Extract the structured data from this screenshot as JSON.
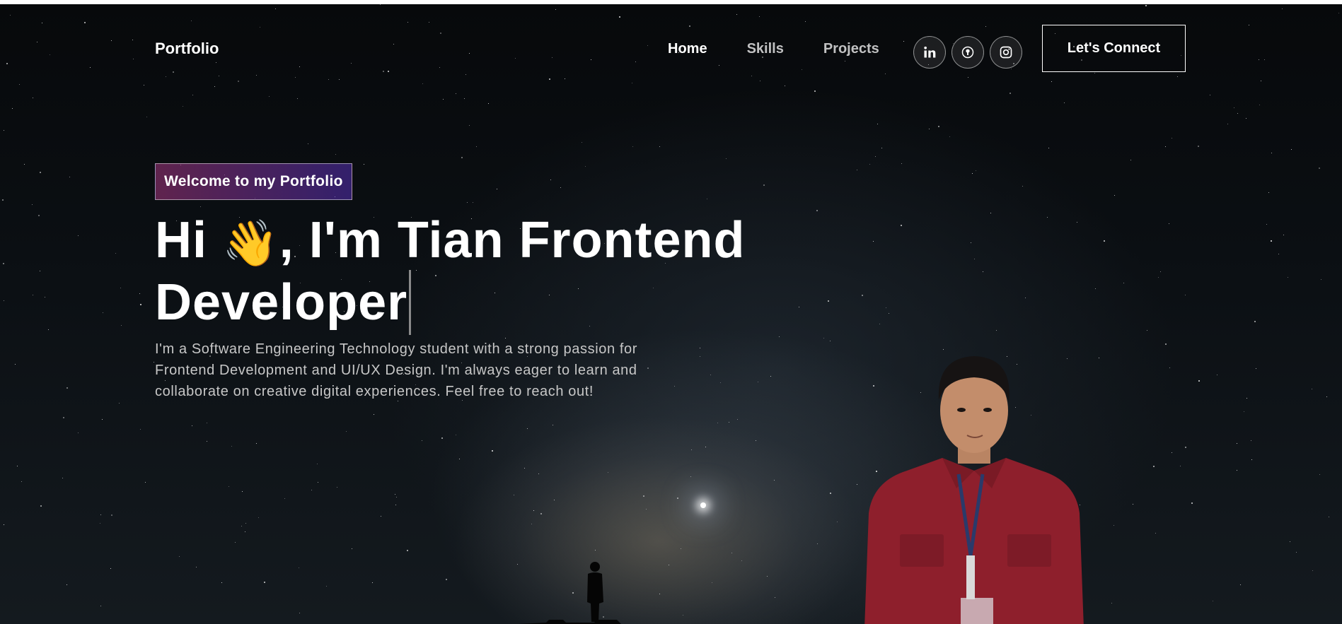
{
  "nav": {
    "logo": "Portfolio",
    "links": [
      {
        "label": "Home",
        "active": true
      },
      {
        "label": "Skills",
        "active": false
      },
      {
        "label": "Projects",
        "active": false
      }
    ],
    "socials": [
      {
        "icon": "linkedin-icon"
      },
      {
        "icon": "github-icon"
      },
      {
        "icon": "instagram-icon"
      }
    ],
    "cta": "Let's Connect"
  },
  "hero": {
    "tagline": "Welcome to my Portfolio",
    "headline_pre": "Hi",
    "headline_emoji": "👋",
    "headline_mid": ", I'm Tian Frontend",
    "headline_line2": "Developer",
    "intro": "I'm a Software Engineering Technology student with a strong passion for Frontend Development and UI/UX Design. I'm always eager to learn and collaborate on creative digital experiences. Feel free to reach out!"
  },
  "theme": {
    "accent_gradient_start": "#AA367C",
    "accent_gradient_end": "#4A2FBD",
    "shirt_color": "#8e1f2c"
  }
}
